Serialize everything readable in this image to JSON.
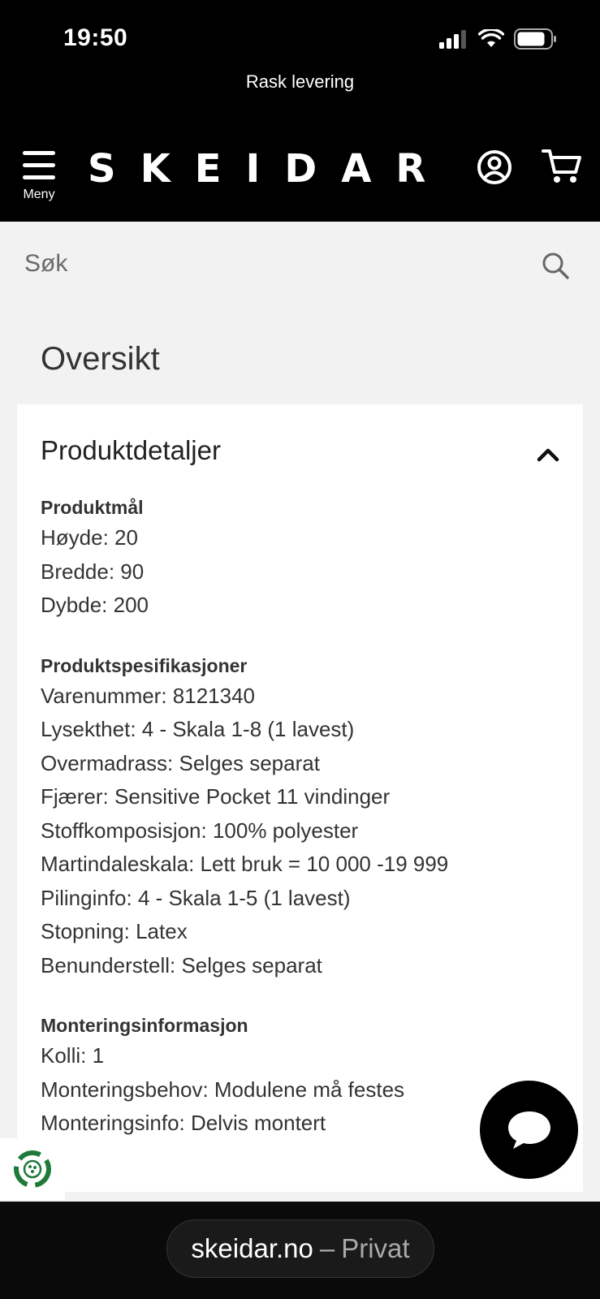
{
  "status_bar": {
    "time": "19:50"
  },
  "header": {
    "promo": "Rask levering",
    "menu_label": "Meny",
    "logo": "SKEIDAR"
  },
  "search": {
    "placeholder": "Søk"
  },
  "page": {
    "overview_title": "Oversikt"
  },
  "details": {
    "title": "Produktdetaljer",
    "sections": [
      {
        "title": "Produktmål",
        "rows": [
          "Høyde: 20",
          "Bredde: 90",
          "Dybde: 200"
        ]
      },
      {
        "title": "Produktspesifikasjoner",
        "rows": [
          "Varenummer: 8121340",
          "Lysekthet: 4 - Skala 1-8 (1 lavest)",
          "Overmadrass: Selges separat",
          "Fjærer: Sensitive Pocket 11 vindinger",
          "Stoffkomposisjon: 100% polyester",
          "Martindaleskala: Lett bruk = 10 000 -19 999",
          "Pilinginfo: 4 - Skala 1-5 (1 lavest)",
          "Stopning: Latex",
          "Benunderstell: Selges separat"
        ]
      },
      {
        "title": "Monteringsinformasjon",
        "rows": [
          "Kolli: 1",
          "Monteringsbehov: Modulene må festes",
          "Monteringsinfo: Delvis montert"
        ]
      }
    ]
  },
  "browser": {
    "domain": "skeidar.no",
    "separator": "–",
    "mode": "Privat"
  },
  "colors": {
    "header_bg": "#000000",
    "page_bg": "#f2f2f2",
    "card_bg": "#ffffff",
    "eco_green": "#1f7a3a"
  },
  "icons": [
    "menu-icon",
    "account-icon",
    "cart-icon",
    "search-icon",
    "chevron-up-icon",
    "chat-icon",
    "eco-icon",
    "signal-icon",
    "wifi-icon",
    "battery-icon"
  ]
}
